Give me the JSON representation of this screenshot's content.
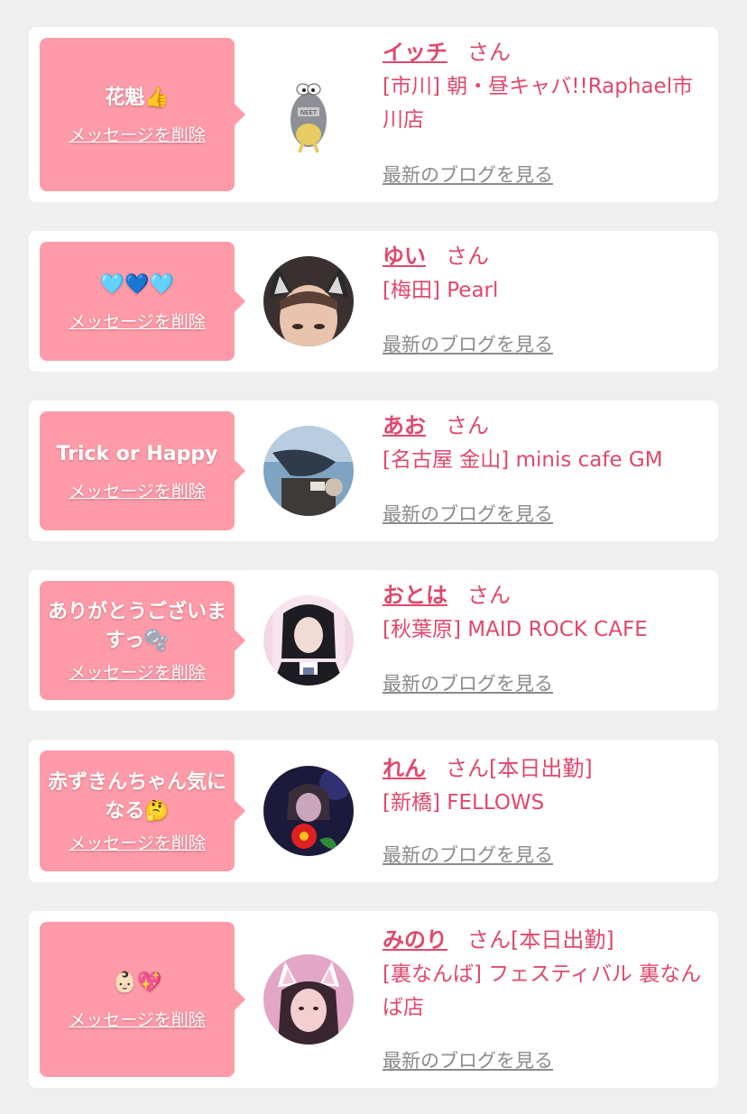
{
  "messages": [
    {
      "message": "花魁👍",
      "delete_label": "メッセージを削除",
      "name": "イッチ",
      "honorific": "さん",
      "status": "",
      "shop": "[市川] 朝・昼キャバ!!Raphael市川店",
      "blog_label": "最新のブログを見る",
      "avatar": "neet-fish-character"
    },
    {
      "message": "🩵💙🩵",
      "delete_label": "メッセージを削除",
      "name": "ゆい",
      "honorific": "さん",
      "status": "",
      "shop": "[梅田] Pearl",
      "blog_label": "最新のブログを見る",
      "avatar": "girl-cat-ears"
    },
    {
      "message": "Trick or Happy",
      "delete_label": "メッセージを削除",
      "name": "あお",
      "honorific": "さん",
      "status": "",
      "shop": "[名古屋 金山] minis cafe GM",
      "blog_label": "最新のブログを見る",
      "avatar": "photo-aquarium"
    },
    {
      "message": "ありがとうございますっ🫧",
      "delete_label": "メッセージを削除",
      "name": "おとは",
      "honorific": "さん",
      "status": "",
      "shop": "[秋葉原] MAID ROCK CAFE",
      "blog_label": "最新のブログを見る",
      "avatar": "girl-maid-outfit"
    },
    {
      "message": "赤ずきんちゃん気になる🤔",
      "delete_label": "メッセージを削除",
      "name": "れん",
      "honorific": "さん",
      "status": "[本日出勤]",
      "shop": "[新橋] FELLOWS",
      "blog_label": "最新のブログを見る",
      "avatar": "girl-red-flower"
    },
    {
      "message": "👶🏻💖",
      "delete_label": "メッセージを削除",
      "name": "みのり",
      "honorific": "さん",
      "status": "[本日出勤]",
      "shop": "[裏なんば] フェスティバル 裏なんば店",
      "blog_label": "最新のブログを見る",
      "avatar": "girl-cat-ears-pink"
    }
  ]
}
